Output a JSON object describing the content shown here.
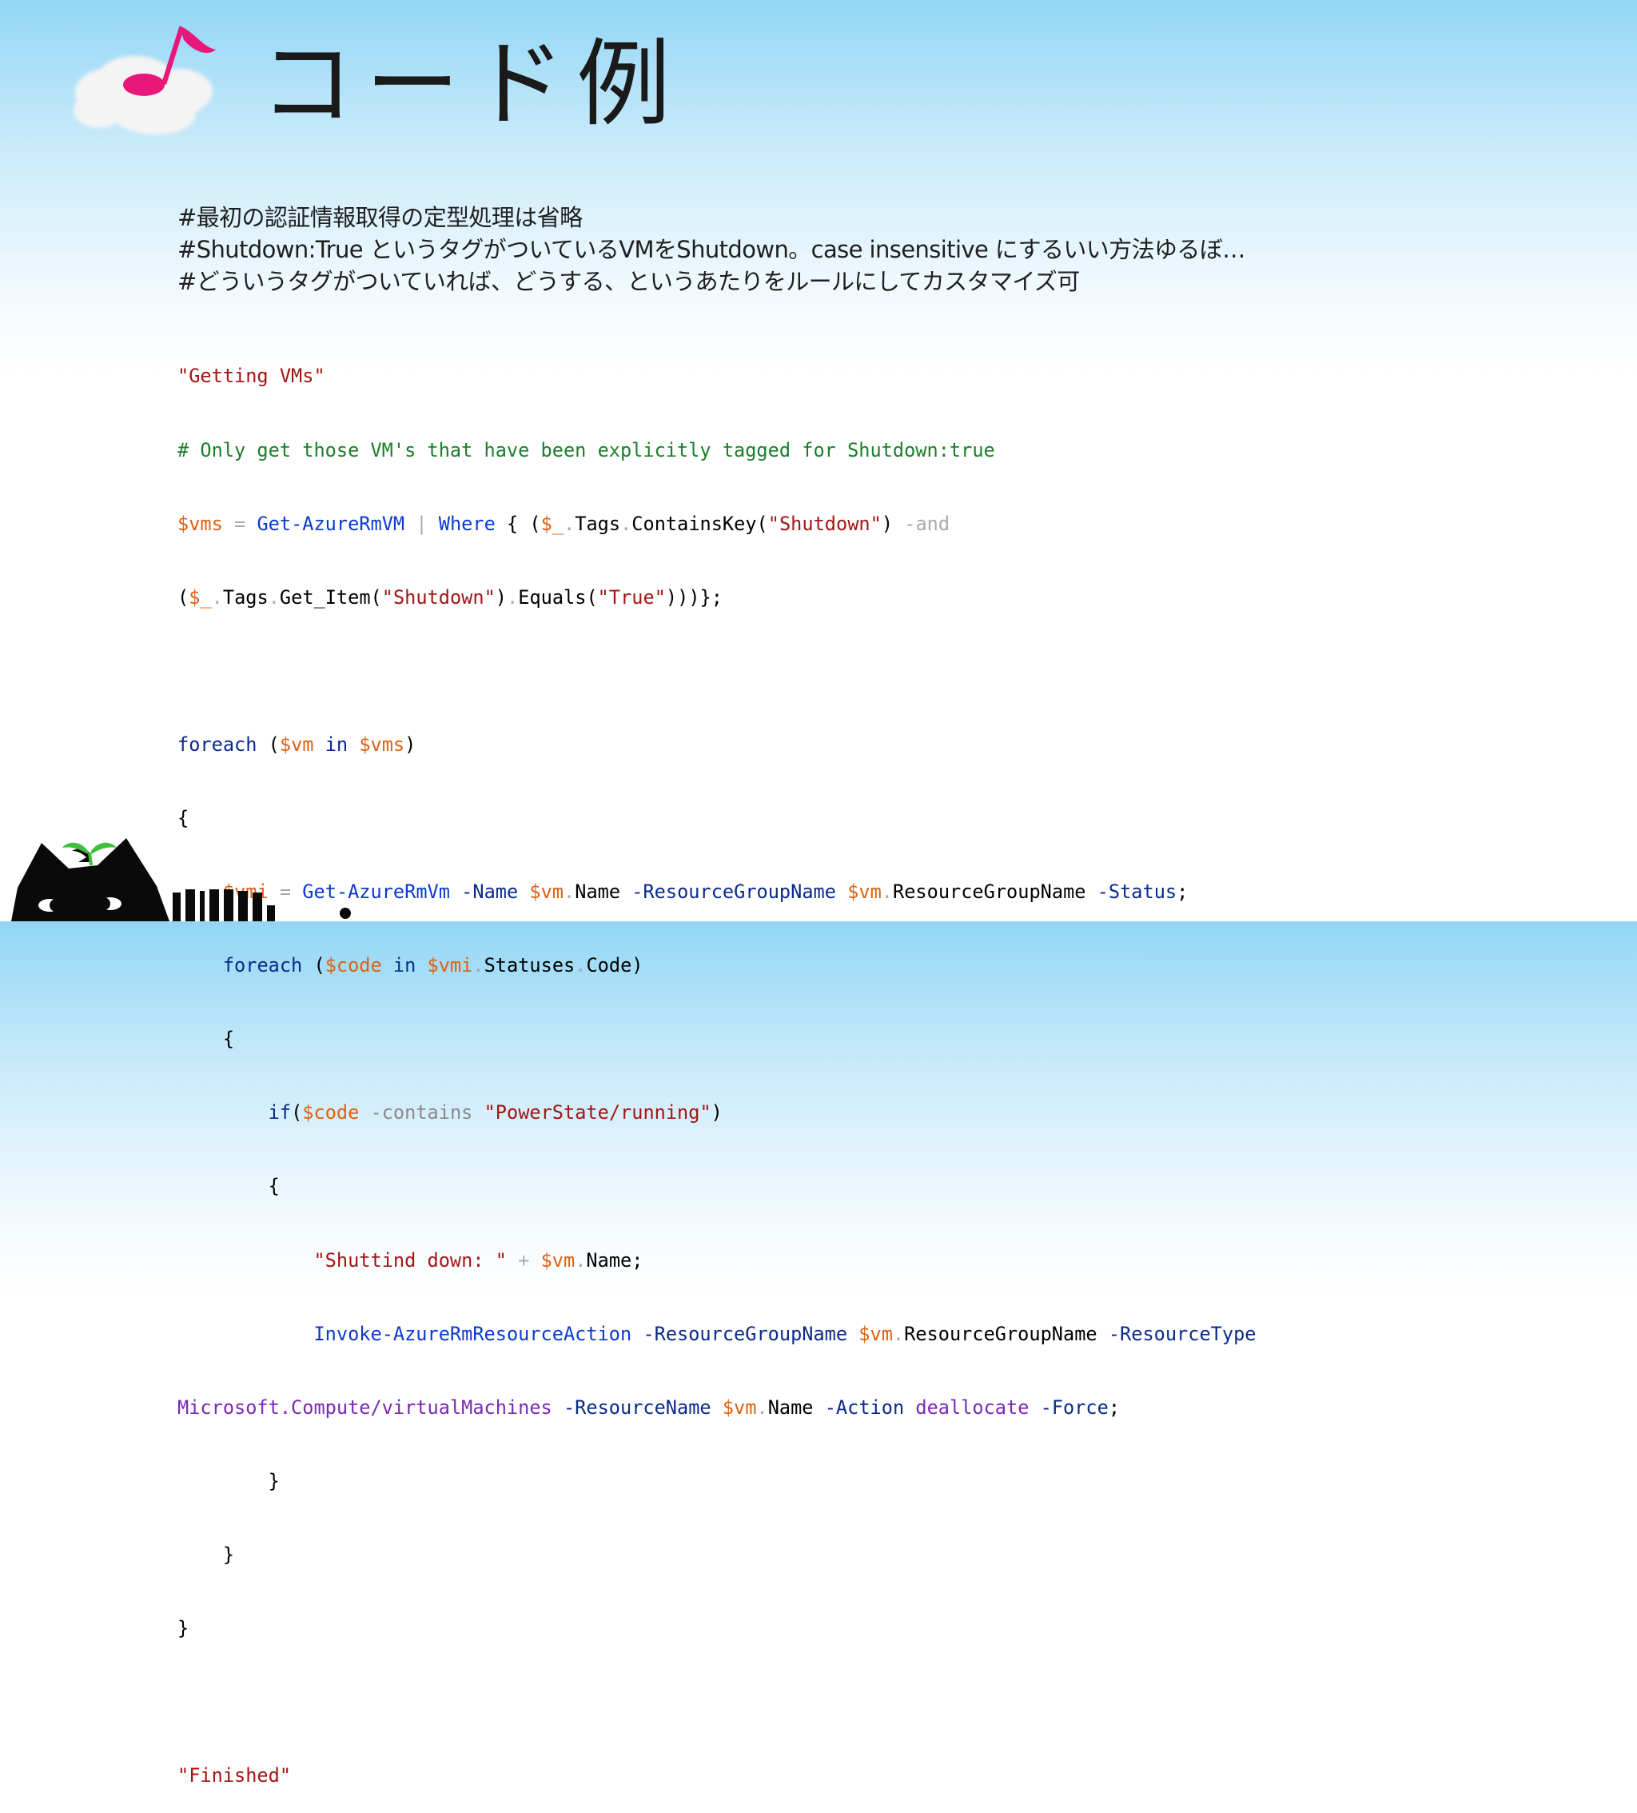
{
  "slide": {
    "title": "コード例"
  },
  "notes": [
    "#最初の認証情報取得の定型処理は省略",
    "#Shutdown:True というタグがついているVMをShutdown。case insensitive にするいい方法ゆるぼ…",
    "#どういうタグがついていれば、どうする、というあたりをルールにしてカスタマイズ可"
  ],
  "code": {
    "l1": {
      "s1": "\"Getting VMs\""
    },
    "l2": {
      "c1": "# Only get those VM's that have been explicitly tagged for Shutdown:true"
    },
    "l3": {
      "v1": "$vms",
      "o1": " = ",
      "k1": "Get-AzureRmVM",
      "o2": " | ",
      "k2": "Where",
      "t1": " { (",
      "v2": "$_",
      "o3": ".",
      "t2": "Tags",
      "o4": ".",
      "t3": "ContainsKey(",
      "s1": "\"Shutdown\"",
      "t4": ") ",
      "o5": "-and"
    },
    "l4": {
      "t1": "(",
      "v1": "$_",
      "o1": ".",
      "t2": "Tags",
      "o2": ".",
      "t3": "Get_Item(",
      "s1": "\"Shutdown\"",
      "t4": ")",
      "o3": ".",
      "t5": "Equals(",
      "s2": "\"True\"",
      "t6": ")))};"
    },
    "l6": {
      "k1": "foreach",
      "t1": " (",
      "v1": "$vm",
      "k2": " in ",
      "v2": "$vms",
      "t2": ")"
    },
    "l7": {
      "t1": "{"
    },
    "l8": {
      "ind": "    ",
      "v1": "$vmi",
      "o1": " = ",
      "k1": "Get-AzureRmVm",
      "p1": " -Name ",
      "v2": "$vm",
      "o2": ".",
      "t1": "Name",
      "p2": " -ResourceGroupName ",
      "v3": "$vm",
      "o3": ".",
      "t2": "ResourceGroupName",
      "p3": " -Status",
      "t3": ";"
    },
    "l9": {
      "ind": "    ",
      "k1": "foreach",
      "t1": " (",
      "v1": "$code",
      "k2": " in ",
      "v2": "$vmi",
      "o1": ".",
      "t2": "Statuses",
      "o2": ".",
      "t3": "Code)"
    },
    "l10": {
      "ind": "    ",
      "t1": "{"
    },
    "l11": {
      "ind": "        ",
      "k1": "if",
      "t1": "(",
      "v1": "$code",
      "o1": " -contains ",
      "s1": "\"PowerState/running\"",
      "t2": ")"
    },
    "l12": {
      "ind": "        ",
      "t1": "{"
    },
    "l13": {
      "ind": "            ",
      "s1": "\"Shuttind down: \"",
      "o1": " + ",
      "v1": "$vm",
      "o2": ".",
      "t1": "Name;"
    },
    "l14": {
      "ind": "            ",
      "k1": "Invoke-AzureRmResourceAction",
      "p1": " -ResourceGroupName ",
      "v1": "$vm",
      "o1": ".",
      "t1": "ResourceGroupName",
      "p2": " -ResourceType"
    },
    "l15": {
      "y1": "Microsoft.Compute/virtualMachines",
      "p1": " -ResourceName ",
      "v1": "$vm",
      "o1": ".",
      "t1": "Name",
      "p2": " -Action ",
      "y2": "deallocate",
      "p3": " -Force",
      "t2": ";"
    },
    "l16": {
      "ind": "        ",
      "t1": "}"
    },
    "l17": {
      "ind": "    ",
      "t1": "}"
    },
    "l18": {
      "t1": "}"
    },
    "l20": {
      "s1": "\"Finished\""
    }
  },
  "colors": {
    "string": "#a31515",
    "comment": "#1a7f2a",
    "variable": "#e06012",
    "cmdlet": "#0b3ad0",
    "keyword": "#0a2a8c",
    "operator": "#a9a9a9",
    "type": "#7a28b8"
  },
  "icons": {
    "logo": "music-note-cloud-icon",
    "mascot": "black-cat-with-sprout-icon"
  }
}
